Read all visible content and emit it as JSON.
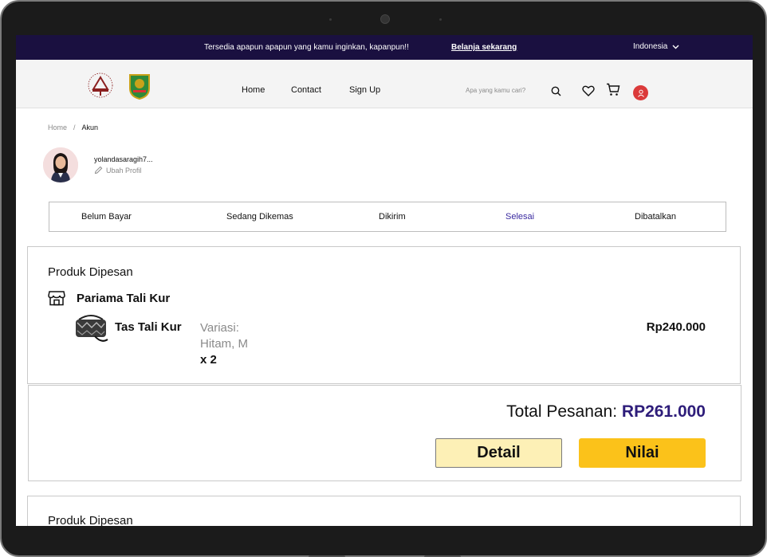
{
  "topbar": {
    "promo": "Tersedia apapun apapun yang kamu inginkan, kapanpun!!",
    "shop_link": "Belanja sekarang",
    "language": "Indonesia"
  },
  "header": {
    "nav": [
      "Home",
      "Contact",
      "Sign Up"
    ],
    "search_placeholder": "Apa yang kamu cari?"
  },
  "breadcrumb": {
    "home": "Home",
    "separator": "/",
    "current": "Akun"
  },
  "profile": {
    "username": "yolandasaragih7...",
    "edit_label": "Ubah Profil"
  },
  "tabs": [
    {
      "label": "Belum Bayar",
      "active": false
    },
    {
      "label": "Sedang Dikemas",
      "active": false
    },
    {
      "label": "Dikirim",
      "active": false
    },
    {
      "label": "Selesai",
      "active": true
    },
    {
      "label": "Dibatalkan",
      "active": false
    }
  ],
  "order": {
    "title": "Produk Dipesan",
    "store": "Pariama Tali Kur",
    "product": "Tas Tali Kur",
    "variation_label": "Variasi:",
    "variation_value": "Hitam, M",
    "quantity": "x 2",
    "price": "Rp240.000",
    "total_label": "Total Pesanan: ",
    "total_amount": "RP261.000",
    "detail_button": "Detail",
    "rate_button": "Nilai"
  },
  "next_order": {
    "title": "Produk Dipesan"
  },
  "colors": {
    "topbar_bg": "#1a1040",
    "active_tab": "#3a2aa0",
    "total_amount": "#2e1d7a",
    "rate_button": "#fbc21a",
    "detail_button": "#fdf0b6",
    "avatar_badge": "#db3a3a"
  },
  "icons": [
    "chevron-down-icon",
    "search-icon",
    "heart-icon",
    "cart-icon",
    "user-icon",
    "pencil-icon",
    "store-icon"
  ]
}
